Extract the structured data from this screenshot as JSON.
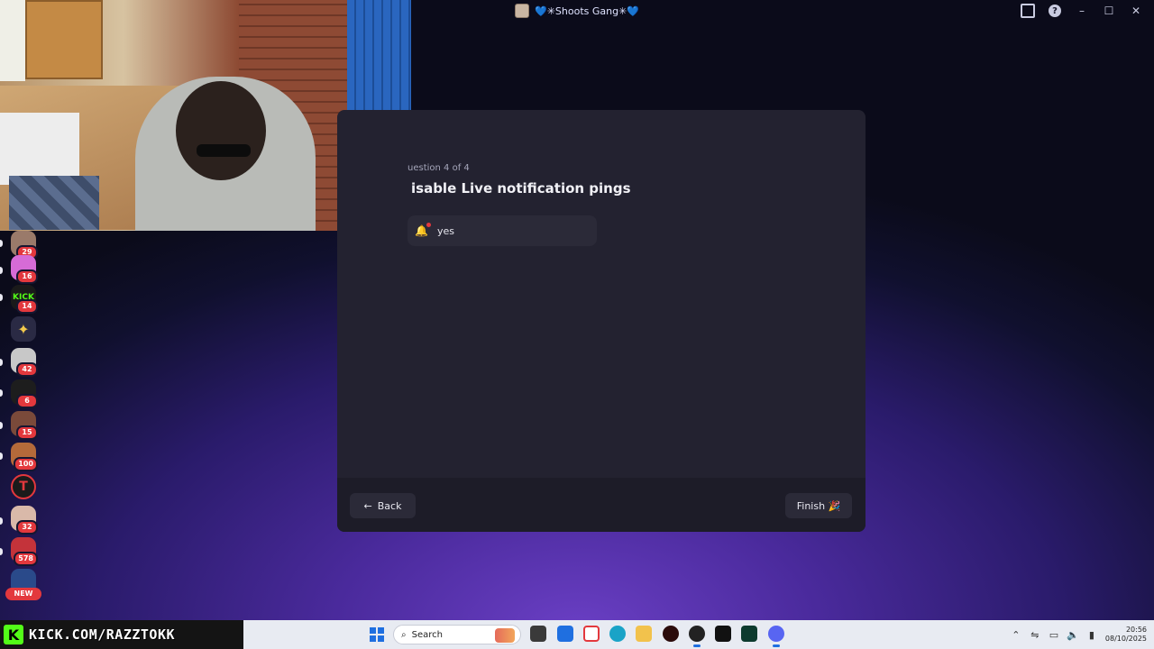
{
  "window": {
    "title": "💙✳Shoots Gang✳💙",
    "controls": {
      "minimize": "–",
      "maximize": "☐",
      "close": "✕"
    },
    "icons": [
      "inbox-icon",
      "help-icon"
    ]
  },
  "sidebar": {
    "servers": [
      {
        "badge": "29",
        "color": "#9a7a6a"
      },
      {
        "badge": "16",
        "color": "#d66bd6"
      },
      {
        "badge": "14",
        "color": "#1a1a1a",
        "label": "KICK"
      },
      {
        "badge": "",
        "color": "#2a2a44",
        "label": "✦"
      },
      {
        "badge": "42",
        "color": "#c8c8c8"
      },
      {
        "badge": "6",
        "color": "#1d1d1d"
      },
      {
        "badge": "15",
        "color": "#7a4a3a"
      },
      {
        "badge": "100",
        "color": "#b56a3a"
      },
      {
        "badge": "",
        "color": "#1b1b1b",
        "label": "T"
      },
      {
        "badge": "32",
        "color": "#d9b9a9"
      },
      {
        "badge": "578",
        "color": "#c4333a"
      },
      {
        "badge": "",
        "color": "#2a4a8a"
      }
    ],
    "new_label": "NEW"
  },
  "onboarding": {
    "counter": "uestion 4 of 4",
    "title": "isable Live notification pings",
    "option_label": "yes",
    "back_label": "Back",
    "finish_label": "Finish 🎉"
  },
  "overlay": {
    "kick_logo": "K",
    "kick_url": "KICK.COM/RAZZTOKK"
  },
  "taskbar": {
    "search_placeholder": "Search",
    "clock_time": "20:56",
    "clock_date": "08/10/2025"
  }
}
